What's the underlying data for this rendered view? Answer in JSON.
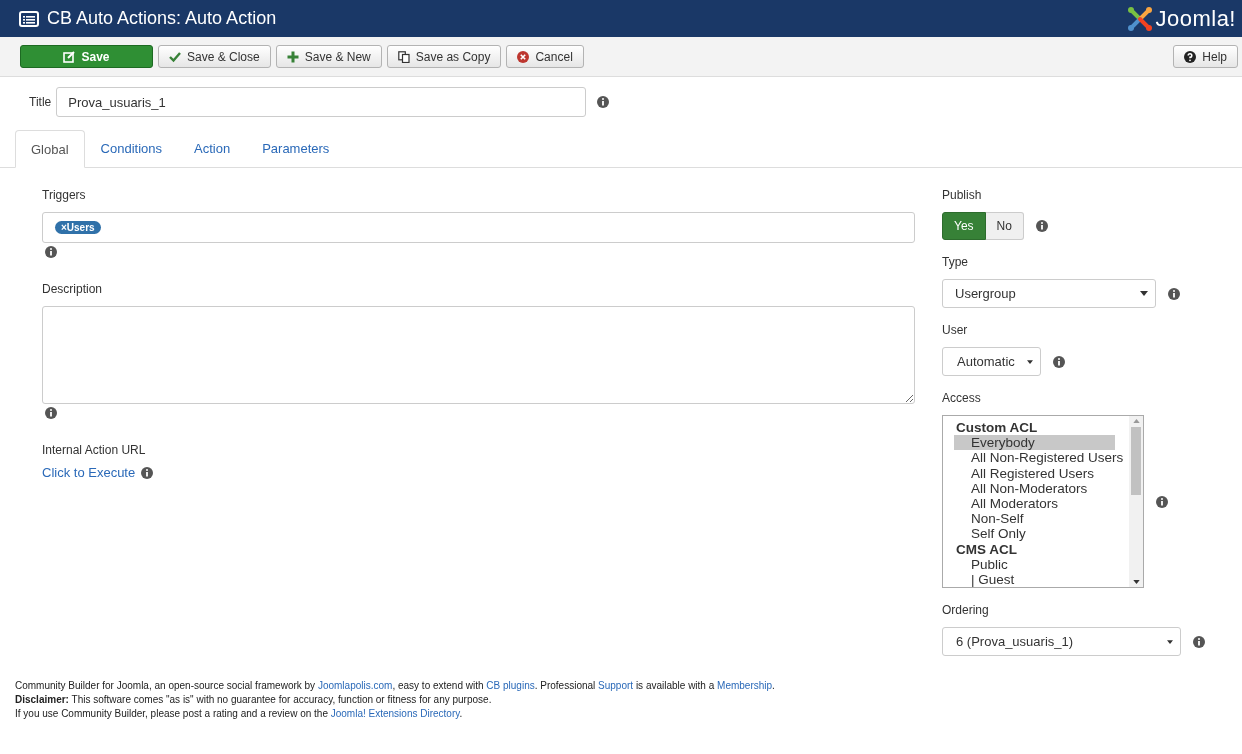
{
  "header": {
    "title": "CB Auto Actions: Auto Action",
    "logo_text": "Joomla!"
  },
  "toolbar": {
    "buttons": [
      {
        "label": "Save",
        "kind": "save"
      },
      {
        "label": "Save & Close",
        "kind": "close"
      },
      {
        "label": "Save & New",
        "kind": "new"
      },
      {
        "label": "Save as Copy",
        "kind": "copy"
      },
      {
        "label": "Cancel",
        "kind": "cancel"
      }
    ],
    "help": "Help"
  },
  "title_field": {
    "label": "Title",
    "value": "Prova_usuaris_1"
  },
  "tabs": [
    {
      "label": "Global",
      "selected": true
    },
    {
      "label": "Conditions",
      "selected": false
    },
    {
      "label": "Action",
      "selected": false
    },
    {
      "label": "Parameters",
      "selected": false
    }
  ],
  "triggers": {
    "label": "Triggers",
    "tags": [
      {
        "remove": "×",
        "label": "Users"
      }
    ]
  },
  "description": {
    "label": "Description"
  },
  "internal_url": {
    "label": "Internal Action URL",
    "link": "Click to Execute"
  },
  "publish": {
    "label": "Publish",
    "options": [
      {
        "label": "Yes",
        "selected": true
      },
      {
        "label": "No",
        "selected": false
      }
    ]
  },
  "type": {
    "label": "Type",
    "value": "Usergroup"
  },
  "user": {
    "label": "User",
    "value": "Automatic"
  },
  "access": {
    "label": "Access",
    "items": [
      {
        "kind": "group",
        "label": "Custom ACL",
        "selected": false
      },
      {
        "kind": "option",
        "label": "Everybody",
        "selected": true
      },
      {
        "kind": "option",
        "label": "All Non-Registered Users",
        "selected": false
      },
      {
        "kind": "option",
        "label": "All Registered Users",
        "selected": false
      },
      {
        "kind": "option",
        "label": "All Non-Moderators",
        "selected": false
      },
      {
        "kind": "option",
        "label": "All Moderators",
        "selected": false
      },
      {
        "kind": "option",
        "label": "Non-Self",
        "selected": false
      },
      {
        "kind": "option",
        "label": "Self Only",
        "selected": false
      },
      {
        "kind": "group",
        "label": "CMS ACL",
        "selected": false
      },
      {
        "kind": "option",
        "label": "Public",
        "selected": false
      },
      {
        "kind": "option",
        "label": "| Guest",
        "selected": false
      }
    ]
  },
  "ordering": {
    "label": "Ordering",
    "value": "6 (Prova_usuaris_1)"
  },
  "footer": [
    [
      {
        "text": "Community Builder for Joomla, an open-source social framework by ",
        "link": false
      },
      {
        "text": "Joomlapolis.com",
        "link": true
      },
      {
        "text": ", easy to extend with ",
        "link": false
      },
      {
        "text": "CB plugins",
        "link": true
      },
      {
        "text": ". Professional ",
        "link": false
      },
      {
        "text": "Support",
        "link": true
      },
      {
        "text": " is available with a ",
        "link": false
      },
      {
        "text": "Membership",
        "link": true
      },
      {
        "text": ".",
        "link": false
      }
    ],
    [
      {
        "text": "**Disclaimer:** This software comes \"as is\" with no guarantee for accuracy, function or fitness for any purpose.",
        "link": false
      }
    ],
    [
      {
        "text": "If you use Community Builder, please post a rating and a review on the ",
        "link": false
      },
      {
        "text": "Joomla! Extensions Directory",
        "link": true
      },
      {
        "text": ".",
        "link": false
      }
    ]
  ]
}
